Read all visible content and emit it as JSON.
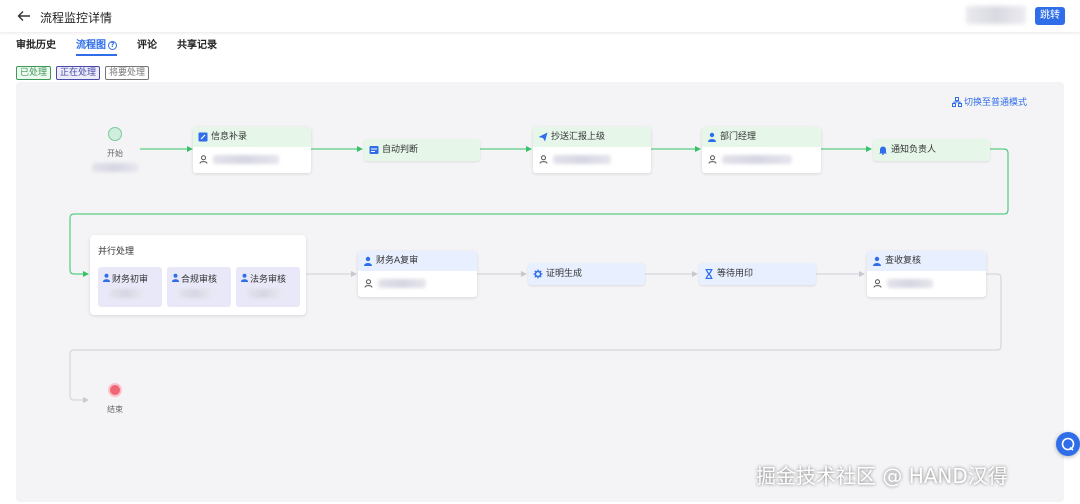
{
  "header": {
    "title": "流程监控详情",
    "jump_label": "跳转"
  },
  "tabs": [
    {
      "label": "审批历史"
    },
    {
      "label": "流程图",
      "active": true
    },
    {
      "label": "评论"
    },
    {
      "label": "共享记录"
    }
  ],
  "legend": {
    "done": "已处理",
    "doing": "正在处理",
    "todo": "将要处理"
  },
  "switch_mode_label": "切换至普通模式",
  "flow": {
    "start_label": "开始",
    "end_label": "结束",
    "nodes": [
      {
        "id": "info",
        "label": "信息补录",
        "status": "done",
        "icon": "edit-icon"
      },
      {
        "id": "auto",
        "label": "自动判断",
        "status": "done",
        "icon": "rule-icon"
      },
      {
        "id": "cc",
        "label": "抄送汇报上级",
        "status": "done",
        "icon": "send-icon"
      },
      {
        "id": "dept",
        "label": "部门经理",
        "status": "done",
        "icon": "user-icon"
      },
      {
        "id": "notify",
        "label": "通知负责人",
        "status": "done",
        "icon": "bell-icon"
      },
      {
        "id": "parallel",
        "label": "并行处理",
        "status": "doing",
        "children": [
          {
            "label": "财务初审",
            "icon": "user-icon"
          },
          {
            "label": "合规审核",
            "icon": "user-icon"
          },
          {
            "label": "法务审核",
            "icon": "user-icon"
          }
        ]
      },
      {
        "id": "finA",
        "label": "财务A复审",
        "status": "todo",
        "icon": "user-icon"
      },
      {
        "id": "cert",
        "label": "证明生成",
        "status": "todo",
        "icon": "gear-icon"
      },
      {
        "id": "seal",
        "label": "等待用印",
        "status": "todo",
        "icon": "hourglass-icon"
      },
      {
        "id": "check",
        "label": "查收复核",
        "status": "todo",
        "icon": "user-icon"
      }
    ]
  },
  "watermark": "掘金技术社区 @ HAND汉得",
  "colors": {
    "accent": "#2f6ee8",
    "done_edge": "#35c267",
    "todo_edge": "#d0d0d6",
    "done_bg": "#e6f7ea",
    "todo_bg": "#e8efff",
    "doing_bg": "#e8e8f8"
  }
}
